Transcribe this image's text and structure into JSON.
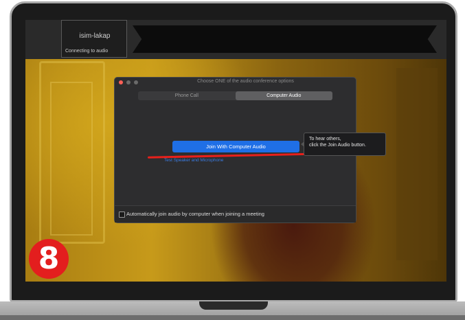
{
  "participant": {
    "name": "isim-lakap",
    "status": "Connecting to audio"
  },
  "dialog": {
    "title": "Choose ONE of the audio conference options",
    "tabs": [
      {
        "label": "Phone Call",
        "active": false
      },
      {
        "label": "Computer Audio",
        "active": true
      }
    ],
    "join_button": "Join With Computer Audio",
    "test_link": "Test Speaker and Microphone",
    "auto_join_label": "Automatically join audio by computer when joining a meeting",
    "auto_join_checked": false
  },
  "tooltip": {
    "line1": "To hear others,",
    "line2": "click the Join Audio button."
  },
  "annotation": {
    "step_number": "8",
    "badge_color": "#e31e1e",
    "underline_color": "#e8201b"
  },
  "colors": {
    "primary_button": "#1f6fe6",
    "dialog_bg": "#2d2d2f"
  }
}
